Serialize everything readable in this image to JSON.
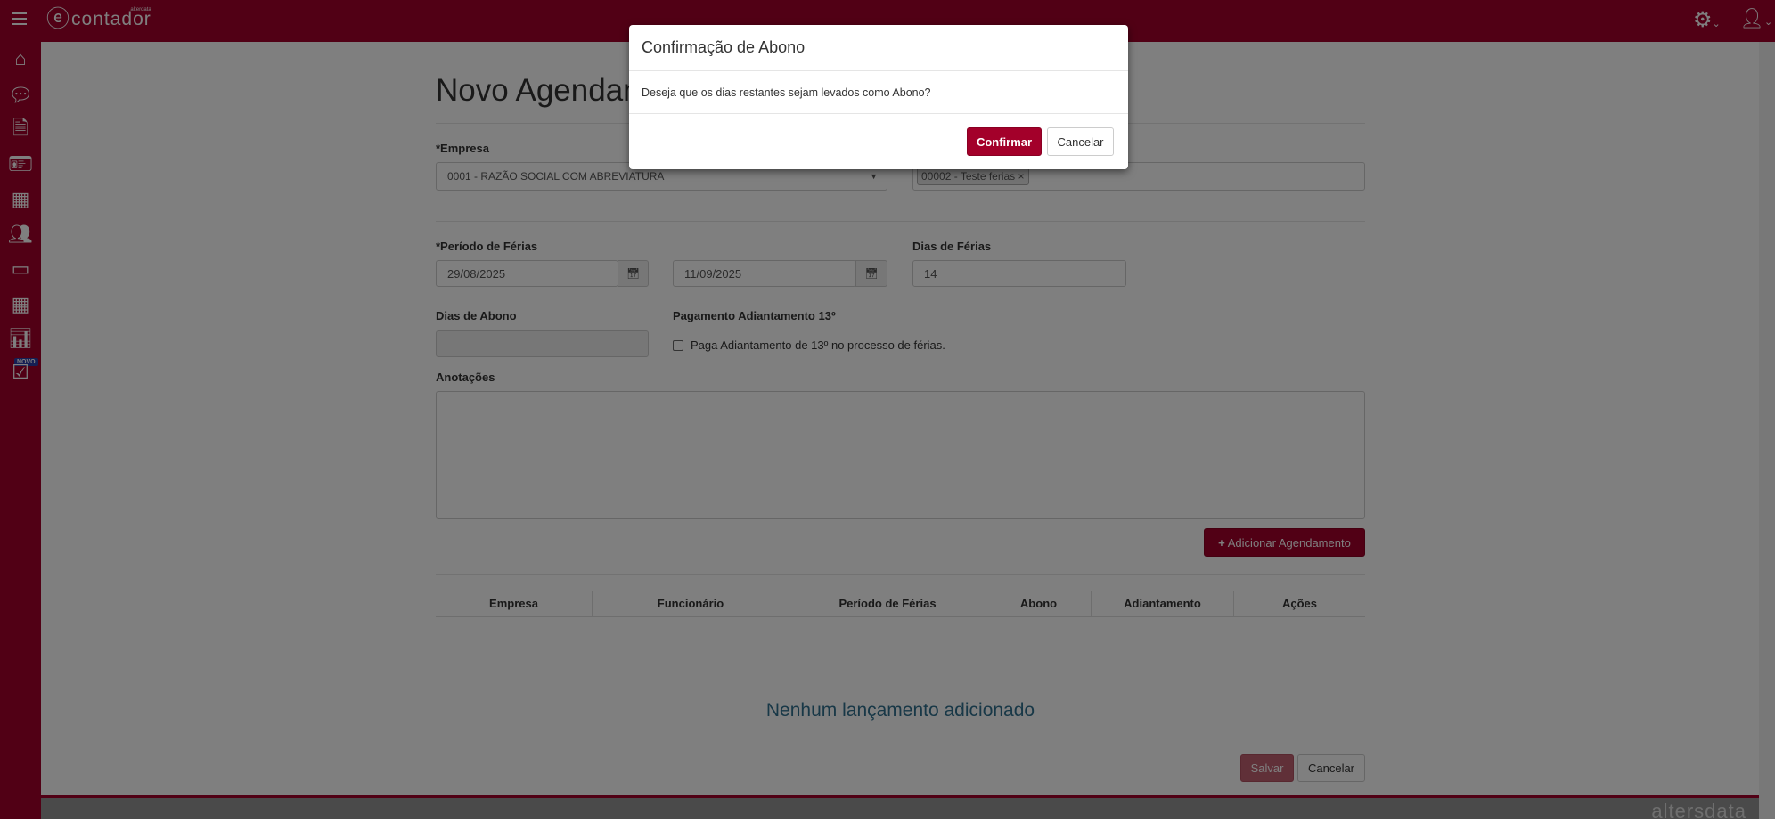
{
  "app": {
    "logo_text": "contador",
    "logo_sub": "alterdata",
    "footer_logo": "altersdata"
  },
  "sidebar": {
    "badge": "NOVO"
  },
  "page": {
    "title": "Novo Agendamento",
    "empresa_label": "*Empresa",
    "empresa_value": "0001 - RAZÃO SOCIAL COM ABREVIATURA",
    "funcionario_tag": "00002 - Teste ferias",
    "periodo_label": "*Período de Férias",
    "data_inicio": "29/08/2025",
    "data_fim": "11/09/2025",
    "dias_ferias_label": "Dias de Férias",
    "dias_ferias_value": "14",
    "dias_abono_label": "Dias de Abono",
    "dias_abono_value": "",
    "pagamento_label": "Pagamento Adiantamento 13º",
    "pagamento_checkbox": "Paga Adiantamento de 13º no processo de férias.",
    "anotacoes_label": "Anotações",
    "add_button": "Adicionar Agendamento",
    "table_headers": [
      "Empresa",
      "Funcionário",
      "Período de Férias",
      "Abono",
      "Adiantamento",
      "Ações"
    ],
    "empty_message": "Nenhum lançamento adicionado",
    "save_button": "Salvar",
    "cancel_button": "Cancelar"
  },
  "modal": {
    "title": "Confirmação de Abono",
    "message": "Deseja que os dias restantes sejam levados como Abono?",
    "confirm": "Confirmar",
    "cancel": "Cancelar"
  }
}
